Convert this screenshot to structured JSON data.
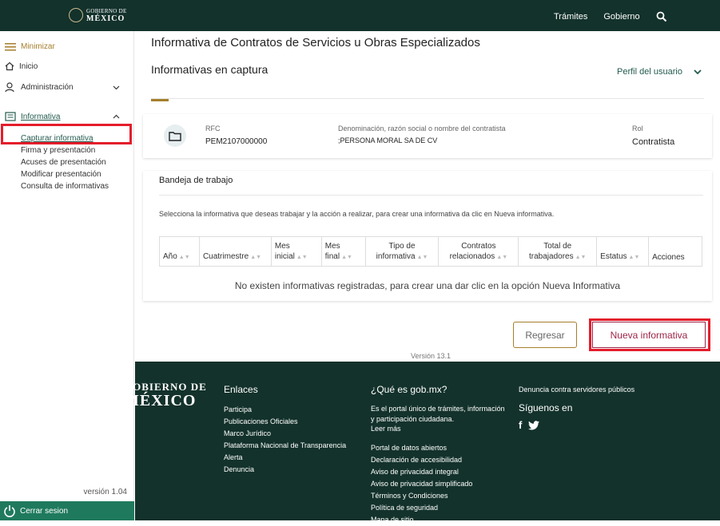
{
  "header": {
    "logo_line1": "GOBIERNO DE",
    "logo_line2": "MÉXICO",
    "links": [
      "Trámites",
      "Gobierno"
    ]
  },
  "sidebar": {
    "minimize": "Minimizar",
    "inicio": "Inicio",
    "administracion": "Administración",
    "informativa": "Informativa",
    "subitems": [
      "Capturar informativa",
      "Firma y presentación",
      "Acuses de presentación",
      "Modificar presentación",
      "Consulta de informativas"
    ],
    "version": "versión 1.04",
    "logout": "Cerrar sesion"
  },
  "main": {
    "title": "Informativa de Contratos de Servicios u Obras Especializados",
    "subtitle": "Informativas en captura",
    "profile": "Perfil del usuario",
    "info": {
      "rfc_label": "RFC",
      "rfc_value": "PEM2107000000",
      "name_label": "Denominación, razón social o nombre del contratista",
      "name_value": ";PERSONA MORAL SA DE CV",
      "rol_label": "Rol",
      "rol_value": "Contratista"
    },
    "tray": {
      "title": "Bandeja de trabajo",
      "instructions": "Selecciona la informativa que deseas trabajar y la acción a realizar, para crear una informativa da clic en Nueva informativa.",
      "columns": [
        "Año",
        "Cuatrimestre",
        "Mes inicial",
        "Mes final",
        "Tipo de informativa",
        "Contratos relacionados",
        "Total de trabajadores",
        "Estatus",
        "Acciones"
      ],
      "empty": "No existen informativas registradas, para crear una dar clic en la opción Nueva Informativa"
    },
    "buttons": {
      "back": "Regresar",
      "new": "Nueva informativa"
    },
    "version": "Versión 13.1"
  },
  "footer": {
    "logo_line1": "GOBIERNO DE",
    "logo_line2": "MÉXICO",
    "links_title": "Enlaces",
    "links": [
      "Participa",
      "Publicaciones Oficiales",
      "Marco Jurídico",
      "Plataforma Nacional de Transparencia",
      "Alerta",
      "Denuncia"
    ],
    "gob_title": "¿Qué es gob.mx?",
    "gob_desc": "Es el portal único de trámites, información y participación ciudadana.",
    "gob_more": "Leer más",
    "gob_links": [
      "Portal de datos abiertos",
      "Declaración de accesibilidad",
      "Aviso de privacidad integral",
      "Aviso de privacidad simplificado",
      "Términos y Condiciones",
      "Política de seguridad",
      "Mapa de sitio"
    ],
    "denuncia": "Denuncia contra servidores públicos",
    "follow": "Síguenos en",
    "social": [
      "f"
    ]
  },
  "colors": {
    "brand_dark": "#13322b",
    "brand_green": "#235b4e",
    "gold": "#a57f2c",
    "wine": "#9d2449",
    "highlight": "#e41d2c"
  },
  "icons": [
    "search-icon",
    "menu-icon",
    "home-icon",
    "user-icon",
    "document-icon",
    "chevron-down-icon",
    "chevron-up-icon",
    "folder-icon",
    "power-icon",
    "twitter-icon"
  ]
}
